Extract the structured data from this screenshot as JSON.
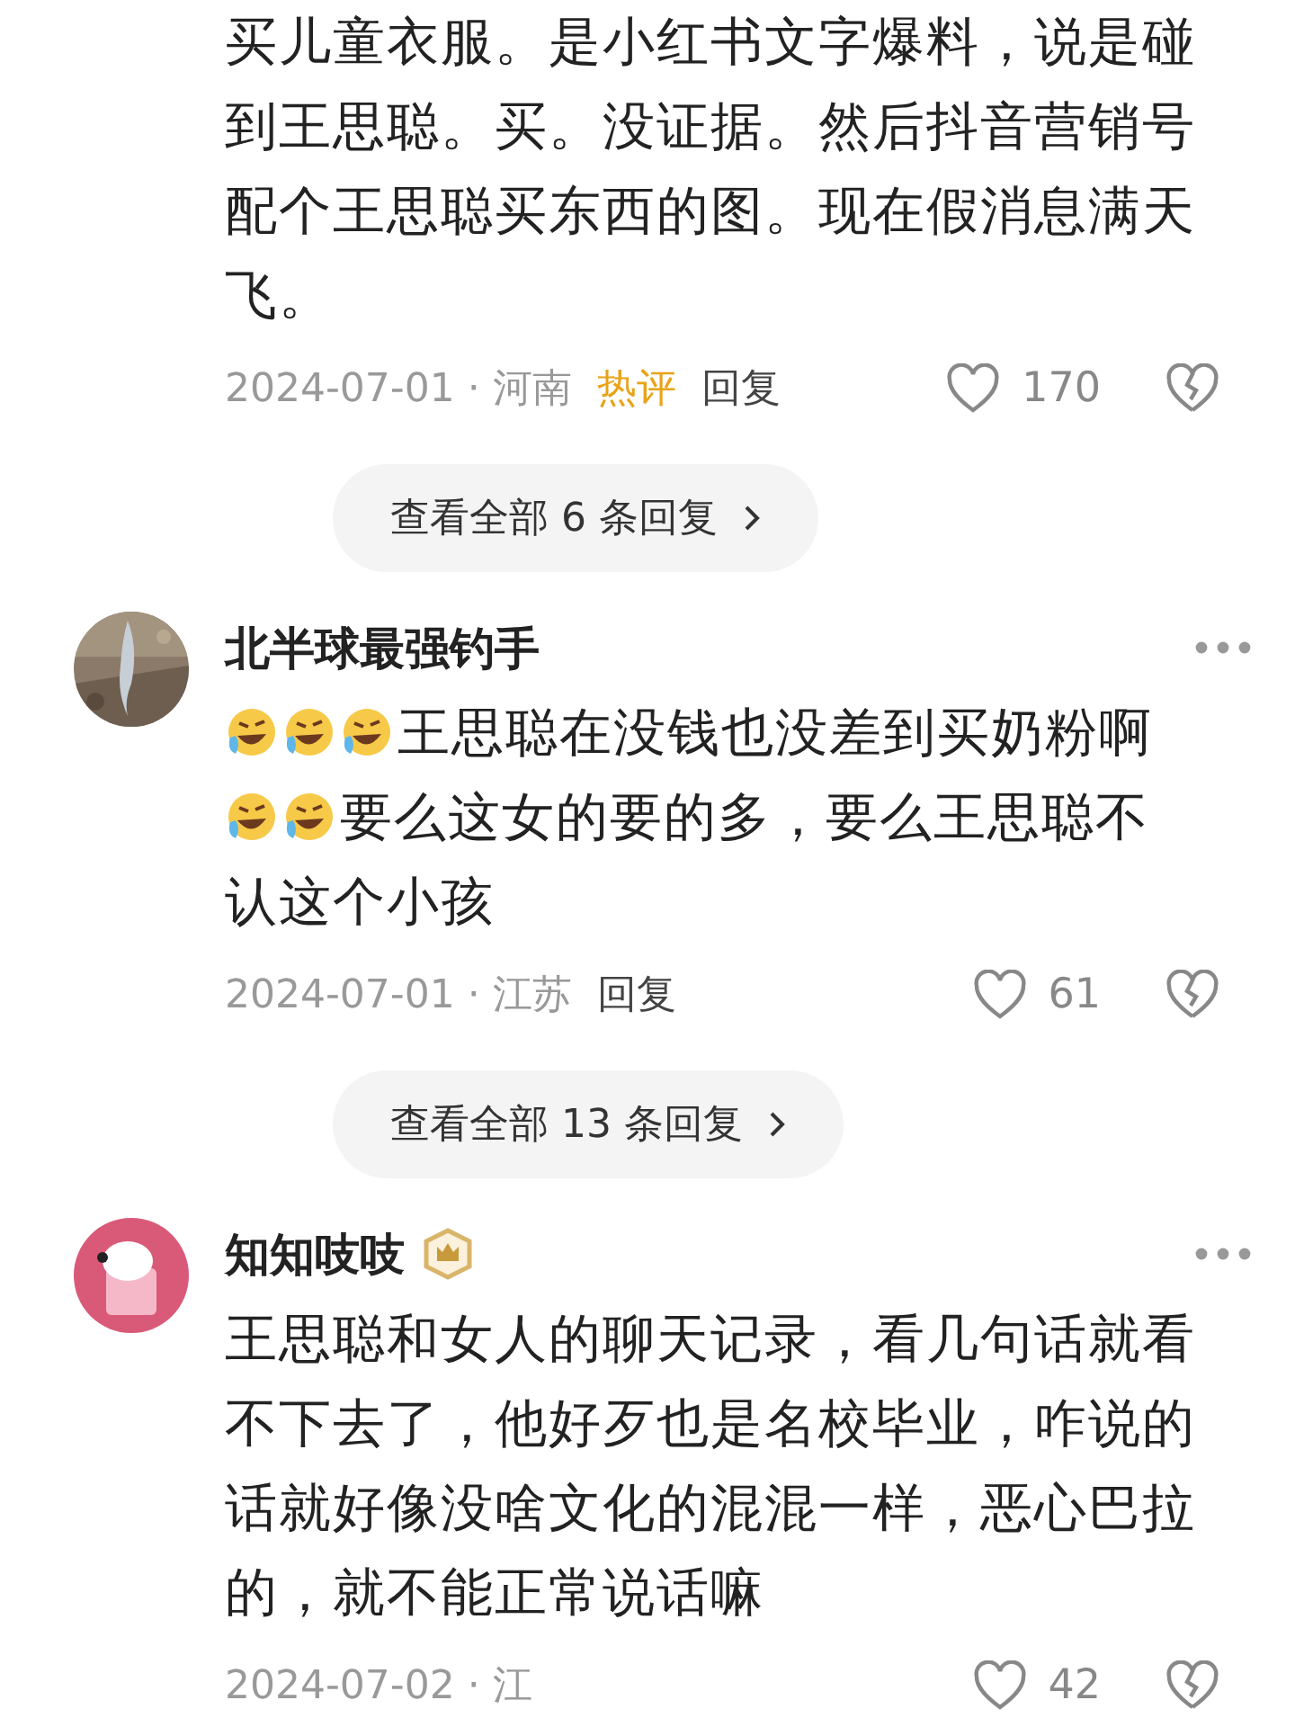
{
  "comments": [
    {
      "body": [
        {
          "kind": "text",
          "text": "买儿童衣服。是小红书文字爆料，说是碰到王思聪。买。没证据。然后抖音营销号配个王思聪买东西的图。现在假消息满天飞。"
        }
      ],
      "date": "2024-07-01 · 河南",
      "hot": "热评",
      "reply": "回复",
      "likes": "170",
      "more_replies": "查看全部 6 条回复"
    },
    {
      "user": {
        "name": "北半球最强钓手",
        "badge": false
      },
      "body": [
        {
          "kind": "emoji"
        },
        {
          "kind": "emoji"
        },
        {
          "kind": "emoji"
        },
        {
          "kind": "text",
          "text": "王思聪在没钱也没差到买奶粉啊"
        },
        {
          "kind": "emoji"
        },
        {
          "kind": "emoji"
        },
        {
          "kind": "text",
          "text": "要么这女的要的多，要么王思聪不"
        },
        {
          "kind": "newline"
        },
        {
          "kind": "text",
          "text": "认这个小孩"
        }
      ],
      "date": "2024-07-01 · 江苏",
      "reply": "回复",
      "likes": "61",
      "more_replies": "查看全部 13 条回复"
    },
    {
      "user": {
        "name": "知知吱吱",
        "avatar": {
          "kind": "icon"
        },
        "badge": true
      },
      "body": [
        {
          "kind": "text",
          "text": "王思聪和女人的聊天记录，看几句话就看不下去了，他好歹也是名校毕业，咋说的话就好像没啥文化的混混一样，恶心巴拉的，就不能正常说话嘛"
        }
      ],
      "date": "2024-07-02 · 江",
      "likes": "42"
    }
  ]
}
